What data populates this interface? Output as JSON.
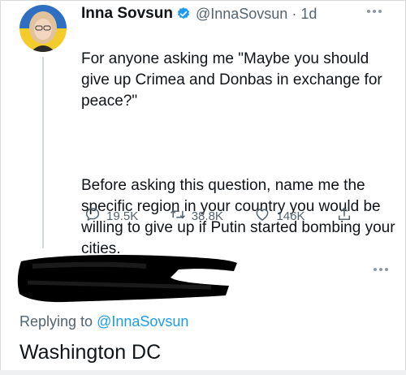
{
  "tweet": {
    "display_name": "Inna Sovsun",
    "handle": "@InnaSovsun",
    "separator": "·",
    "time": "1d",
    "paragraph_1": "For anyone asking me \"Maybe you should give up Crimea and Donbas in exchange for peace?\"",
    "paragraph_2": "Before asking this question, name me the specific region in your country you would be willing to give up if Putin started bombing your cities.",
    "stats": {
      "replies": "19.5K",
      "retweets": "38.8K",
      "likes": "146K"
    }
  },
  "reply": {
    "replying_prefix": "Replying to",
    "replying_to": "@InnaSovsun",
    "text": "Washington DC"
  },
  "colors": {
    "text_primary": "#0f1419",
    "text_secondary": "#536471",
    "link_blue": "#1d9bf0",
    "verified_blue": "#1d9bf0",
    "flag_blue": "#2f6fc1",
    "flag_yellow": "#f3cc2c",
    "redaction": "#000000"
  },
  "icons": [
    "verified-badge-icon",
    "more-icon",
    "reply-icon",
    "retweet-icon",
    "like-icon",
    "share-icon"
  ]
}
